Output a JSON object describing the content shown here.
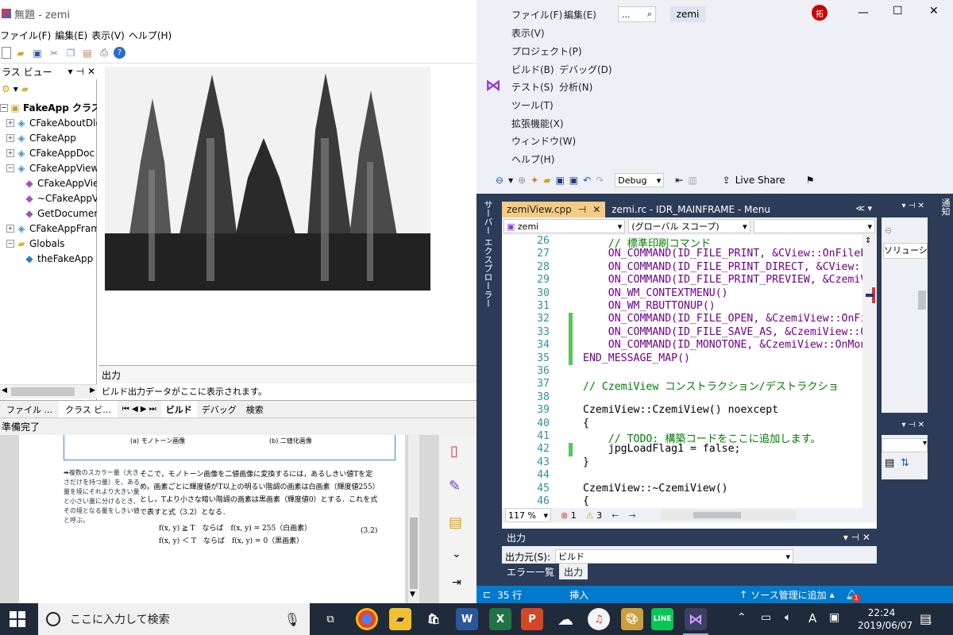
{
  "mfc": {
    "title": "無題 - zemi",
    "menu": [
      "ファイル(F)",
      "編集(E)",
      "表示(V)",
      "ヘルプ(H)"
    ],
    "classview": {
      "title": "クラス ビュー",
      "root": "FakeApp クラス",
      "items": [
        "CFakeAboutDlg",
        "CFakeApp",
        "CFakeAppDoc",
        "CFakeAppView",
        "CFakeAppView",
        "~CFakeAppVi",
        "GetDocument",
        "CFakeAppFrame",
        "Globals",
        "theFakeApp"
      ]
    },
    "output": {
      "title": "出力",
      "line1": "ビルド出力データがここに表示されます。"
    },
    "tabs": [
      "ファイル ...",
      "クラス ビ...",
      "ビルド",
      "デバッグ",
      "検索"
    ],
    "status": "準備完了"
  },
  "pdf": {
    "caption_a": "(a) モノトーン画像",
    "caption_b": "(b) 二値化画像",
    "sidenote": "➡複数のスカラー量（大きさだけを持つ量）を、ある量を境にそれより大きい量と小さい量に分けるとき、その境となる量をしきい値と呼ぶ。",
    "body": "そこで，モノトーン画像を二値画像に変換するには，あるしきい値Tを定め，画素ごとに輝度値がT以上の明るい階調の画素は白画素（輝度値255）とし，Tより小さな暗い階調の画素は黒画素（輝度値0）とする．これを式で表すと式（3.2）となる．",
    "eq1": "f(x, y) ≧ T　ならば　f(x, y) = 255（白画素）",
    "eq2": "f(x, y) ＜ T　ならば　f(x, y) = 0（黒画素）",
    "eqnum": "(3.2)"
  },
  "vs": {
    "menu": [
      "ファイル(F)",
      "編集(E)",
      "表示(V)",
      "プロジェクト(P)",
      "ビルド(B)",
      "デバッグ(D)",
      "テスト(S)",
      "分析(N)",
      "ツール(T)",
      "拡張機能(X)",
      "ウィンドウ(W)",
      "ヘルプ(H)"
    ],
    "search_label": "...",
    "solution_name": "zemi",
    "avatar": "拓",
    "config": "Debug",
    "live_share": "Live Share",
    "server_explorer": "サーバー エクスプローラー",
    "tab_active": "zemiView.cpp",
    "tab_inactive": "zemi.rc - IDR_MAINFRAME - Menu",
    "nav_project": "zemi",
    "nav_scope": "(グローバル スコープ)",
    "code_lines": [
      {
        "n": "26",
        "t": "    // 標準印刷コマンド"
      },
      {
        "n": "27",
        "t": "    ON_COMMAND(ID_FILE_PRINT, &CView::OnFilePr"
      },
      {
        "n": "28",
        "t": "    ON_COMMAND(ID_FILE_PRINT_DIRECT, &CView::O"
      },
      {
        "n": "29",
        "t": "    ON_COMMAND(ID_FILE_PRINT_PREVIEW, &CzemiV"
      },
      {
        "n": "30",
        "t": "    ON_WM_CONTEXTMENU()"
      },
      {
        "n": "31",
        "t": "    ON_WM_RBUTTONUP()"
      },
      {
        "n": "32",
        "t": "    ON_COMMAND(ID_FILE_OPEN, &CzemiView::OnFi"
      },
      {
        "n": "33",
        "t": "    ON_COMMAND(ID_FILE_SAVE_AS, &CzemiView::Or"
      },
      {
        "n": "34",
        "t": "    ON_COMMAND(ID_MONOTONE, &CzemiView::OnMono"
      },
      {
        "n": "35",
        "t": "END_MESSAGE_MAP()"
      },
      {
        "n": "36",
        "t": ""
      },
      {
        "n": "37",
        "t": "// CzemiView コンストラクション/デストラクショ"
      },
      {
        "n": "38",
        "t": ""
      },
      {
        "n": "39",
        "t": "CzemiView::CzemiView() noexcept"
      },
      {
        "n": "40",
        "t": "{"
      },
      {
        "n": "41",
        "t": "    // TODO: 構築コードをここに追加します。"
      },
      {
        "n": "42",
        "t": "    jpgLoadFlag1 = false;"
      },
      {
        "n": "43",
        "t": "}"
      },
      {
        "n": "44",
        "t": ""
      },
      {
        "n": "45",
        "t": "CzemiView::~CzemiView()"
      },
      {
        "n": "46",
        "t": "{"
      }
    ],
    "zoom": "117 %",
    "errors": "1",
    "warnings": "3",
    "output_title": "出力",
    "output_source_label": "出力元(S):",
    "output_source": "ビルド",
    "bottom_tabs": [
      "エラー一覧",
      "出力"
    ],
    "solution_label": "ソリューショ",
    "notify": "通知",
    "status_line": "35 行",
    "status_insert": "挿入",
    "status_scm": "ソース管理に追加",
    "notif_count": "1"
  },
  "taskbar": {
    "search_placeholder": "ここに入力して検索",
    "time": "22:24",
    "date": "2019/06/07",
    "notify_count": "1",
    "ime": "A"
  }
}
